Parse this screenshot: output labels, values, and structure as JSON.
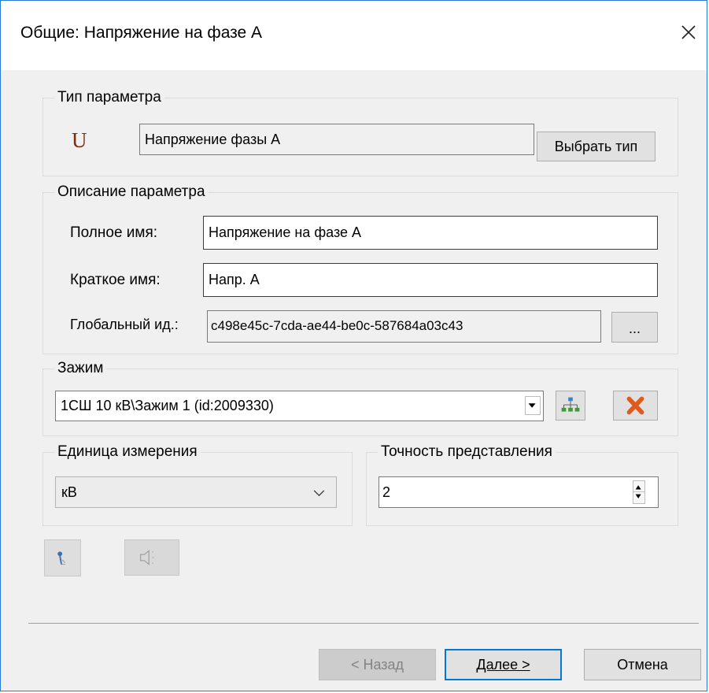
{
  "window": {
    "title": "Общие: Напряжение на фазе А"
  },
  "param_type": {
    "legend": "Тип параметра",
    "icon": "U",
    "value": "Напряжение фазы А",
    "select_button": "Выбрать тип"
  },
  "description": {
    "legend": "Описание параметра",
    "full_name_label": "Полное имя:",
    "full_name_value": "Напряжение на фазе А",
    "short_name_label": "Краткое имя:",
    "short_name_value": "Напр. А",
    "global_id_label": "Глобальный ид.:",
    "global_id_value": "c498e45c-7cda-ae44-be0c-587684a03c43",
    "browse_button": "..."
  },
  "clamp": {
    "legend": "Зажим",
    "value": "1СШ 10 кВ\\Зажим 1 (id:2009330)"
  },
  "unit": {
    "legend": "Единица измерения",
    "value": "кВ"
  },
  "precision": {
    "legend": "Точность представления",
    "value": "2"
  },
  "footer": {
    "back_button": "< Назад",
    "next_button": "Далее >",
    "cancel_button": "Отмена"
  },
  "colors": {
    "accent_border": "#2b79d6",
    "type_icon": "#7b2c12",
    "delete_icon": "#e05a1e",
    "tree_icon": "#3a9a3a"
  }
}
